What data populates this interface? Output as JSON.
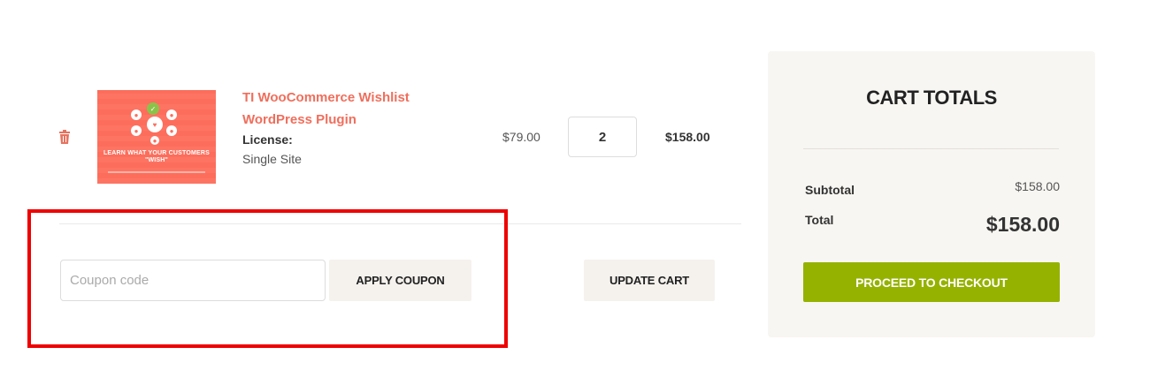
{
  "cart_item": {
    "remove_icon": "trash-icon",
    "product_name": "TI WooCommerce Wishlist WordPress Plugin",
    "thumbnail_caption": "LEARN WHAT YOUR CUSTOMERS \"WISH\"",
    "license_label": "License:",
    "license_value": "Single Site",
    "unit_price": "$79.00",
    "quantity": "2",
    "line_subtotal": "$158.00"
  },
  "actions": {
    "coupon_placeholder": "Coupon code",
    "apply_coupon_label": "APPLY COUPON",
    "update_cart_label": "UPDATE CART"
  },
  "cart_totals": {
    "title": "CART TOTALS",
    "subtotal_label": "Subtotal",
    "subtotal_value": "$158.00",
    "total_label": "Total",
    "total_value": "$158.00",
    "checkout_label": "PROCEED TO CHECKOUT"
  },
  "colors": {
    "accent_link": "#f06e5c",
    "checkout_green": "#95b200",
    "highlight_red": "#ef0000",
    "totals_bg": "#f8f6f2",
    "button_bg": "#f5f2ee"
  }
}
